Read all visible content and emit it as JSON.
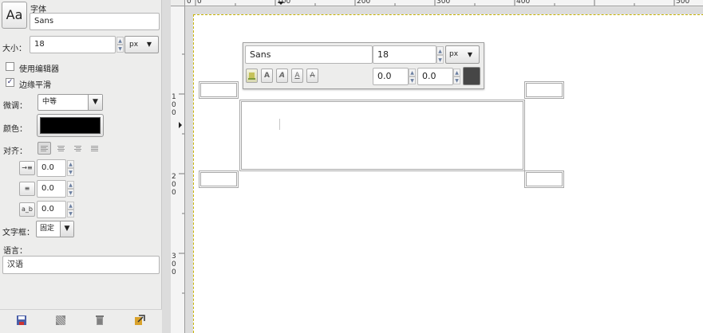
{
  "left_panel": {
    "font_label": "字体",
    "font_preview_glyph": "Aa",
    "font_value": "Sans",
    "size_label": "大小：",
    "size_value": "18",
    "unit_value": "px",
    "use_editor_label": "使用编辑器",
    "use_editor_checked": false,
    "antialias_label": "边缘平滑",
    "antialias_checked": true,
    "hinting_label": "微调：",
    "hinting_value": "中等",
    "color_label": "颜色：",
    "color_value": "#000000",
    "justify_label": "对齐：",
    "indent_value": "0.0",
    "line_spacing_value": "0.0",
    "letter_spacing_value": "0.0",
    "letter_spacing_icon_text": "a_b",
    "box_label": "文字框：",
    "box_value": "固定",
    "language_label": "语言：",
    "language_value": "汉语"
  },
  "rulers": {
    "h_ticks": [
      "0",
      "100",
      "200",
      "300",
      "400",
      "500"
    ],
    "v_ticks": [
      "100",
      "200",
      "300"
    ]
  },
  "text_toolbar": {
    "font_value": "Sans",
    "size_value": "18",
    "unit_value": "px",
    "baseline_value": "0.0",
    "kerning_value": "0.0",
    "style_button_glyph": "A",
    "color_value": "#464646"
  },
  "icons": {
    "bottom": [
      "save-icon",
      "restore-icon",
      "delete-icon",
      "reset-icon"
    ]
  }
}
